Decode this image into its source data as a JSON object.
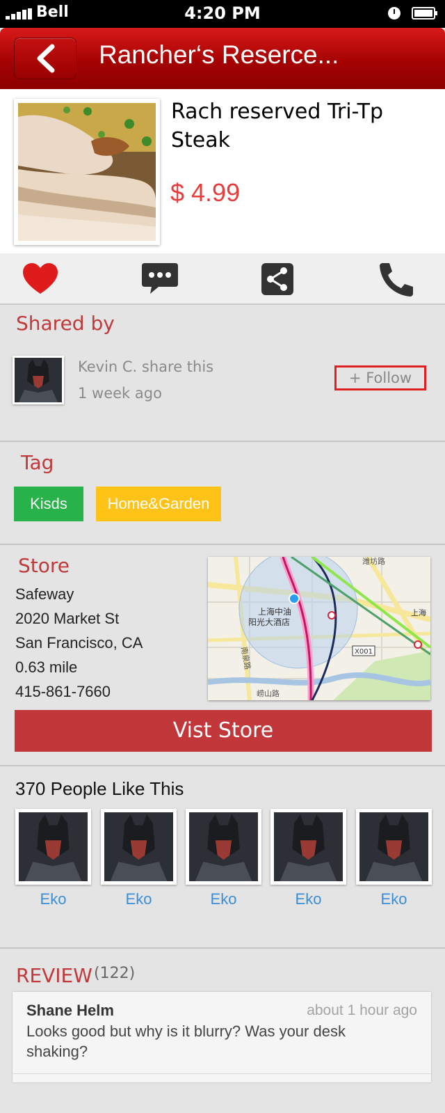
{
  "status_bar": {
    "carrier": "Bell",
    "time": "4:20 PM"
  },
  "nav": {
    "title": "Rancher‘s Reserce..."
  },
  "product": {
    "title": "Rach reserved Tri-Tp Steak",
    "price": "$ 4.99"
  },
  "actions": [
    {
      "icon": "heart-icon",
      "color": "#e01b1b"
    },
    {
      "icon": "comment-icon",
      "color": "#333333"
    },
    {
      "icon": "share-icon",
      "color": "#333333"
    },
    {
      "icon": "phone-icon",
      "color": "#333333"
    }
  ],
  "shared": {
    "title": "Shared by",
    "user_line": "Kevin C.  share this",
    "time": "1 week ago",
    "follow_label": "+ Follow"
  },
  "tags": {
    "title": "Tag",
    "items": [
      {
        "label": "Kisds",
        "color": "#27b24a"
      },
      {
        "label": "Home&Garden",
        "color": "#ffc317"
      }
    ]
  },
  "store": {
    "title": "Store",
    "name": "Safeway",
    "address": "2020 Market St",
    "city": "San Francisco, CA",
    "distance": "0.63 mile",
    "phone": "415-861-7660",
    "visit_label": "Vist  Store",
    "map_labels": {
      "poi1": "上海中油",
      "poi2": "阳光大酒店",
      "road1": "南泉路",
      "road2": "崂山路",
      "bus": "X001",
      "top": "潍坊路",
      "right": "上海"
    }
  },
  "likes": {
    "count_label": "370 People Like This",
    "users": [
      {
        "name": "Eko"
      },
      {
        "name": "Eko"
      },
      {
        "name": "Eko"
      },
      {
        "name": "Eko"
      },
      {
        "name": "Eko"
      }
    ]
  },
  "review": {
    "title": "REVIEW",
    "count": "(122)",
    "items": [
      {
        "author": "Shane Helm",
        "time": "about 1 hour ago",
        "text": "Looks good but why is it blurry? Was your desk shaking?"
      }
    ]
  }
}
